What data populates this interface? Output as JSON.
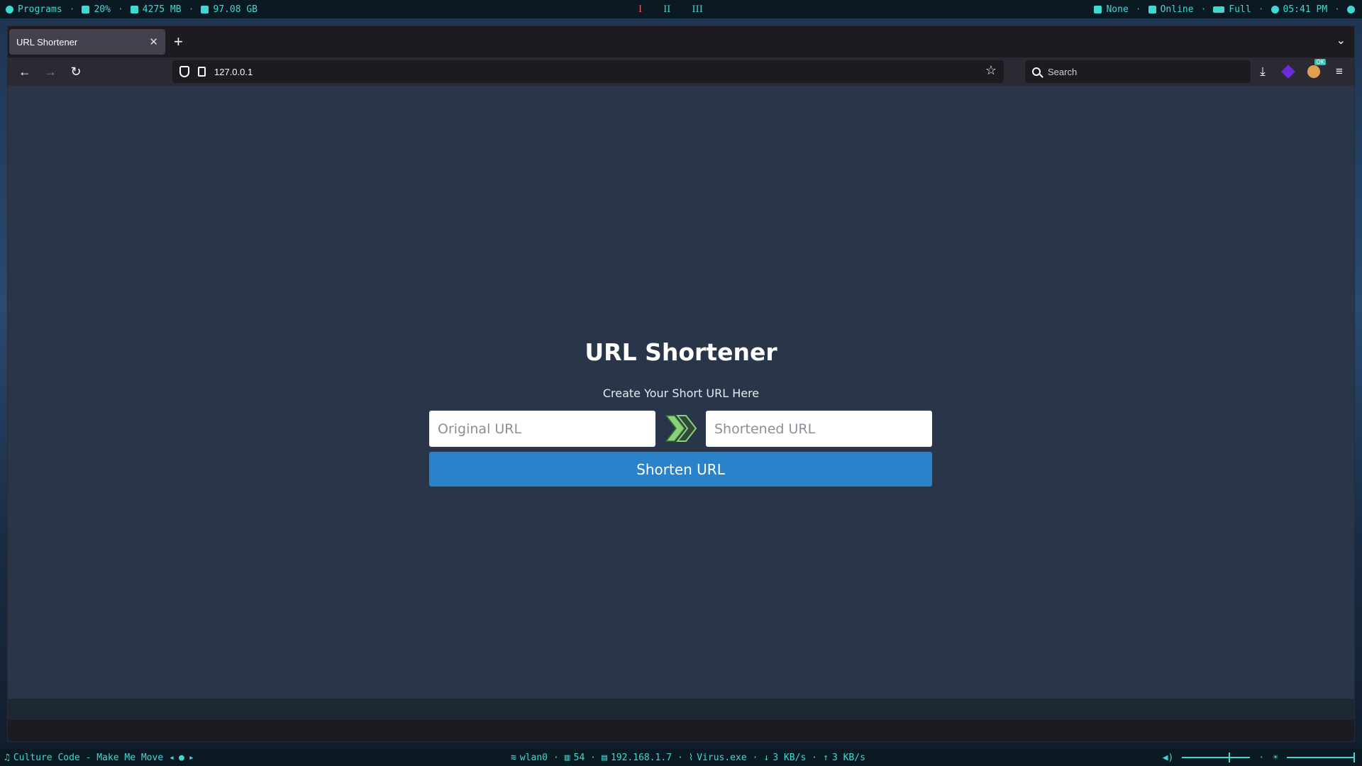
{
  "topbar": {
    "programs": "Programs",
    "cpu": "20%",
    "memory": "4275 MB",
    "disk": "97.08 GB",
    "workspaces": [
      "I",
      "II",
      "III"
    ],
    "notifications": "None",
    "network": "Online",
    "battery": "Full",
    "clock": "05:41 PM"
  },
  "browser": {
    "tab_title": "URL Shortener",
    "url": "127.0.0.1",
    "search_placeholder": "Search"
  },
  "page": {
    "title": "URL Shortener",
    "subtitle": "Create Your Short URL Here",
    "original_placeholder": "Original URL",
    "shortened_placeholder": "Shortened URL",
    "button_label": "Shorten URL",
    "colors": {
      "background": "#293649",
      "button": "#2a82cb",
      "arrow": "#8ad17a"
    }
  },
  "bottombar": {
    "music": "Culture Code - Make Me Move",
    "interface": "wlan0",
    "signal": "54",
    "ip": "192.168.1.7",
    "process": "Virus.exe",
    "download": "3 KB/s",
    "upload": "3 KB/s",
    "volume_level": 0.68,
    "brightness_level": 0.98
  }
}
